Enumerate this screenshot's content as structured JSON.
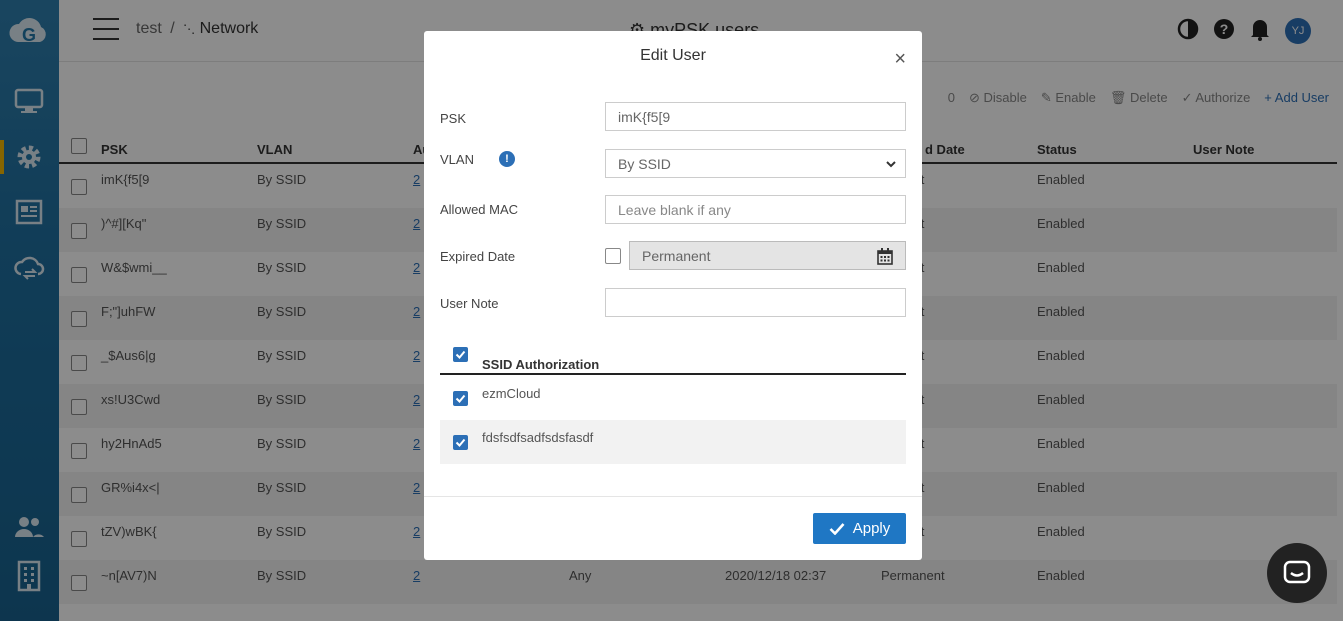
{
  "header": {
    "breadcrumb_org": "test",
    "breadcrumb_sep": "/",
    "breadcrumb_network": "Network",
    "page_title": "myPSK users",
    "avatar_initials": "YJ"
  },
  "toolbar": {
    "count_suffix": "0",
    "disable": "Disable",
    "enable": "Enable",
    "delete": "Delete",
    "authorize": "Authorize",
    "add_user": "Add User"
  },
  "table": {
    "columns": [
      "PSK",
      "VLAN",
      "Au",
      "d Date",
      "Status",
      "User Note"
    ],
    "rows": [
      {
        "psk": "imK{f5[9",
        "vlan": "By SSID",
        "auth": "2",
        "allowed": "",
        "created": "",
        "expired": "manent",
        "status": "Enabled"
      },
      {
        "psk": ")^#][Kq\"",
        "vlan": "By SSID",
        "auth": "2",
        "allowed": "",
        "created": "",
        "expired": "manent",
        "status": "Enabled"
      },
      {
        "psk": "W&$wmi__",
        "vlan": "By SSID",
        "auth": "2",
        "allowed": "",
        "created": "",
        "expired": "manent",
        "status": "Enabled"
      },
      {
        "psk": "F;\"]uhFW",
        "vlan": "By SSID",
        "auth": "2",
        "allowed": "",
        "created": "",
        "expired": "manent",
        "status": "Enabled"
      },
      {
        "psk": "_$Aus6|g",
        "vlan": "By SSID",
        "auth": "2",
        "allowed": "",
        "created": "",
        "expired": "manent",
        "status": "Enabled"
      },
      {
        "psk": "xs!U3Cwd",
        "vlan": "By SSID",
        "auth": "2",
        "allowed": "",
        "created": "",
        "expired": "manent",
        "status": "Enabled"
      },
      {
        "psk": "hy2HnAd5",
        "vlan": "By SSID",
        "auth": "2",
        "allowed": "",
        "created": "",
        "expired": "manent",
        "status": "Enabled"
      },
      {
        "psk": "GR%i4x<|",
        "vlan": "By SSID",
        "auth": "2",
        "allowed": "",
        "created": "",
        "expired": "manent",
        "status": "Enabled"
      },
      {
        "psk": "tZV)wBK{",
        "vlan": "By SSID",
        "auth": "2",
        "allowed": "",
        "created": "",
        "expired": "manent",
        "status": "Enabled"
      },
      {
        "psk": "~n[AV7)N",
        "vlan": "By SSID",
        "auth": "2",
        "allowed": "Any",
        "created": "2020/12/18 02:37",
        "expired": "Permanent",
        "status": "Enabled"
      }
    ]
  },
  "modal": {
    "title": "Edit User",
    "close": "×",
    "psk_label": "PSK",
    "psk_value": "imK{f5[9",
    "vlan_label": "VLAN",
    "vlan_value": "By SSID",
    "mac_label": "Allowed MAC",
    "mac_placeholder": "Leave blank if any",
    "expired_label": "Expired Date",
    "expired_value": "Permanent",
    "note_label": "User Note",
    "note_value": "",
    "ssid_header": "SSID Authorization",
    "ssids": [
      "ezmCloud",
      "fdsfsdfsadfsdsfasdf"
    ],
    "apply": "Apply"
  },
  "colors": {
    "sidebar": "#2277a8",
    "accent": "#1f77c4",
    "active_marker": "#f5b800"
  }
}
